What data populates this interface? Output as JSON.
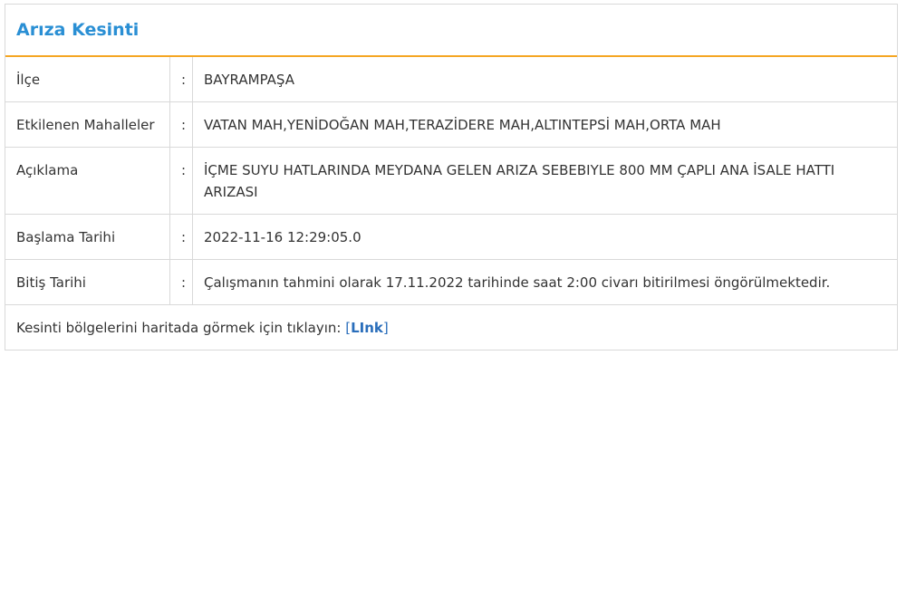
{
  "panel": {
    "title": "Arıza Kesinti"
  },
  "rows": [
    {
      "label": "İlçe",
      "separator": ":",
      "value": "BAYRAMPAŞA"
    },
    {
      "label": "Etkilenen Mahalleler",
      "separator": ":",
      "value": "VATAN MAH,YENİDOĞAN MAH,TERAZİDERE MAH,ALTINTEPSİ MAH,ORTA MAH"
    },
    {
      "label": "Açıklama",
      "separator": ":",
      "value": "İÇME SUYU HATLARINDA MEYDANA GELEN ARIZA SEBEBIYLE 800 MM ÇAPLI ANA İSALE HATTI ARIZASI"
    },
    {
      "label": "Başlama Tarihi",
      "separator": ":",
      "value": "2022-11-16 12:29:05.0"
    },
    {
      "label": "Bitiş Tarihi",
      "separator": ":",
      "value": "Çalışmanın tahmini olarak 17.11.2022 tarihinde saat 2:00 civarı bitirilmesi öngörülmektedir."
    }
  ],
  "footer": {
    "text": "Kesinti bölgelerini haritada görmek için tıklayın: ",
    "link_open": "[",
    "link_label": "LInk",
    "link_close": "]"
  },
  "colors": {
    "title": "#2a8fd4",
    "header_rule": "#f5a623",
    "border": "#d9d9d9",
    "link": "#2a6ebb"
  }
}
